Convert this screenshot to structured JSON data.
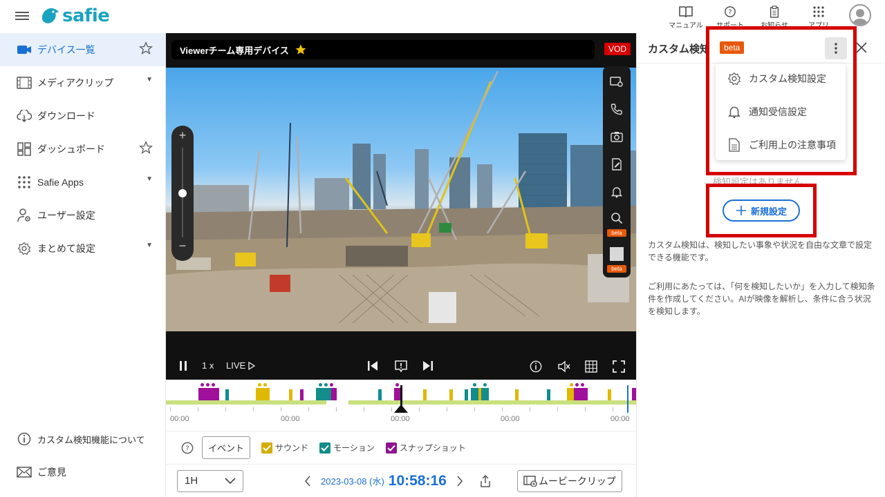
{
  "brand": {
    "logo_text": "safie",
    "accent": "#1aa3c0",
    "primary": "#1a6fd6"
  },
  "header": {
    "actions": [
      {
        "label": "マニュアル",
        "icon": "book-icon"
      },
      {
        "label": "サポート",
        "icon": "help-icon"
      },
      {
        "label": "お知らせ",
        "icon": "clipboard-icon"
      },
      {
        "label": "アプリ",
        "icon": "apps-grid-icon"
      }
    ]
  },
  "sidebar": {
    "items": [
      {
        "label": "デバイス一覧",
        "icon": "camera-icon",
        "active": true
      },
      {
        "label": "メディアクリップ",
        "icon": "film-icon"
      },
      {
        "label": "ダウンロード",
        "icon": "cloud-download-icon"
      },
      {
        "label": "ダッシュボード",
        "icon": "dashboard-icon"
      },
      {
        "label": "Safie Apps",
        "icon": "dots-grid-icon"
      },
      {
        "label": "ユーザー設定",
        "icon": "user-gear-icon"
      },
      {
        "label": "まとめて設定",
        "icon": "gear-icon"
      }
    ],
    "bottom": [
      {
        "label": "カスタム検知機能について",
        "icon": "info-icon"
      },
      {
        "label": "ご意見",
        "icon": "mail-icon"
      }
    ]
  },
  "video": {
    "device_name": "Viewerチーム専用デバイス",
    "mode_badge": "VOD",
    "speed": "1 x",
    "live_label": "LIVE",
    "tool_badges": [
      "beta",
      "beta"
    ]
  },
  "timeline": {
    "tick_labels": [
      "00:00",
      "00:00",
      "00:00",
      "00:00",
      "00:00"
    ],
    "colors": {
      "sound": "#e0b800",
      "motion": "#138c8c",
      "snapshot": "#a0109a",
      "band": "#c8e07e"
    }
  },
  "legend": {
    "event_button": "イベント",
    "items": [
      {
        "label": "サウンド",
        "color": "#d4ad00"
      },
      {
        "label": "モーション",
        "color": "#138c8c"
      },
      {
        "label": "スナップショット",
        "color": "#8e148e"
      }
    ]
  },
  "bottom_bar": {
    "range": "1H",
    "date": "2023-03-08 (水)",
    "time": "10:58:16",
    "movie_clip": "ムービークリップ"
  },
  "panel": {
    "title": "カスタム検知",
    "badge": "beta",
    "menu": [
      {
        "label": "カスタム検知設定",
        "icon": "gear-icon"
      },
      {
        "label": "通知受信設定",
        "icon": "bell-icon"
      },
      {
        "label": "ご利用上の注意事項",
        "icon": "document-icon"
      }
    ],
    "empty_text": "検知設定はありません",
    "new_button": "新規設定",
    "desc1": "カスタム検知は、検知したい事象や状況を自由な文章で設定できる機能です。",
    "desc2": "ご利用にあたっては、「何を検知したいか」を入力して検知条件を作成してください。AIが映像を解析し、条件に合う状況を検知します。"
  }
}
